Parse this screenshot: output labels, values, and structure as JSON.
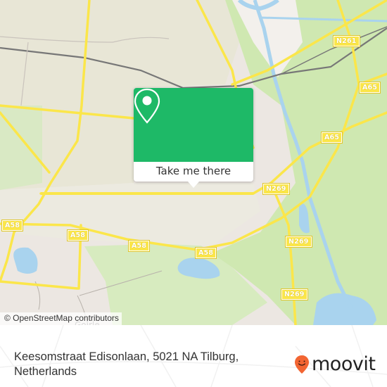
{
  "map": {
    "road_labels": [
      {
        "text": "N261",
        "pos": "top-right"
      },
      {
        "text": "A65",
        "pos": "right-upper"
      },
      {
        "text": "A65",
        "pos": "right-middle"
      },
      {
        "text": "N269",
        "pos": "center-right"
      },
      {
        "text": "N269",
        "pos": "right-lower"
      },
      {
        "text": "N269",
        "pos": "bottom-right"
      },
      {
        "text": "A58",
        "pos": "left"
      },
      {
        "text": "A58",
        "pos": "left-center"
      },
      {
        "text": "A58",
        "pos": "center"
      },
      {
        "text": "A58",
        "pos": "center-bottom"
      }
    ],
    "place_labels": [
      {
        "text": "Goirle"
      }
    ],
    "attribution": "© OpenStreetMap contributors",
    "colors": {
      "land": "#ece7e2",
      "park": "#cfe8b1",
      "water": "#a9d3ee",
      "road_major": "#fbe64a",
      "rail": "#777777"
    }
  },
  "popup": {
    "button_label": "Take me there",
    "pin_icon": "map-pin-icon",
    "accent_color": "#1eb967"
  },
  "footer": {
    "address_line1": "Keesomstraat Edisonlaan, 5021 NA Tilburg,",
    "address_line2": "Netherlands",
    "brand_name": "moovit",
    "brand_icon": "moovit-pin-logo-icon",
    "brand_color": "#f26532"
  }
}
